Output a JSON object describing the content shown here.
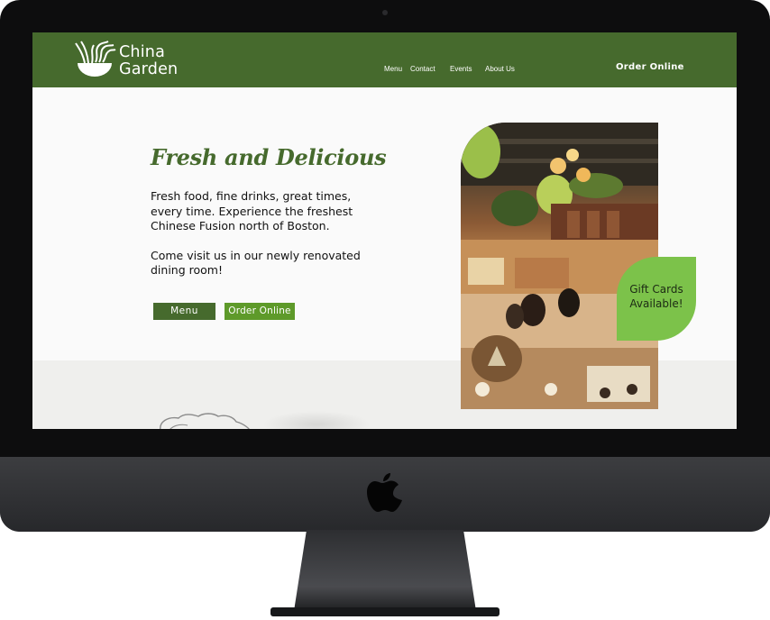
{
  "brand": {
    "name_line1": "China",
    "name_line2": "Garden"
  },
  "nav": {
    "items": [
      "Menu",
      "Contact",
      "Events",
      "About Us"
    ],
    "order_online": "Order Online"
  },
  "hero": {
    "title": "Fresh and Delicious",
    "paragraph1": "Fresh food, fine drinks, great times, every time. Experience the freshest Chinese Fusion north of Boston.",
    "paragraph2": "Come visit us in our newly renovated dining room!",
    "menu_button": "Menu",
    "order_button": "Order Online"
  },
  "gift_badge": {
    "line1": "Gift Cards",
    "line2": "Available!"
  },
  "colors": {
    "brand_green": "#466a2d",
    "accent_green": "#5e9a2a",
    "badge_green": "#7cc24a",
    "band_gray": "#efefed"
  },
  "icons": {
    "logo": "noodle-bowl-icon",
    "device_logo": "apple-icon"
  }
}
